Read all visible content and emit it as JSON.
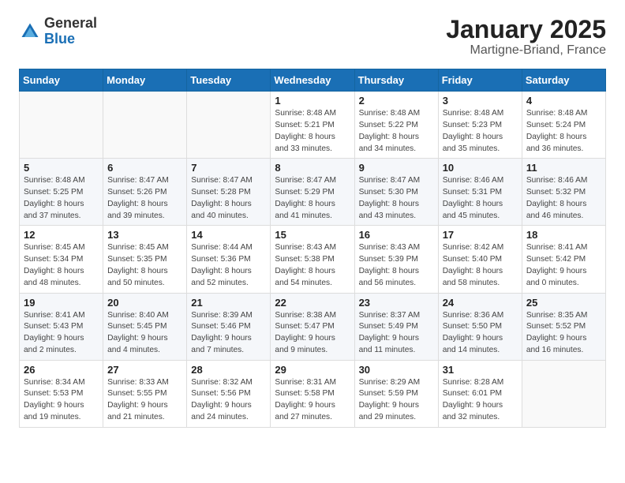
{
  "header": {
    "logo_line1": "General",
    "logo_line2": "Blue",
    "title": "January 2025",
    "subtitle": "Martigne-Briand, France"
  },
  "weekdays": [
    "Sunday",
    "Monday",
    "Tuesday",
    "Wednesday",
    "Thursday",
    "Friday",
    "Saturday"
  ],
  "weeks": [
    [
      {
        "day": "",
        "info": ""
      },
      {
        "day": "",
        "info": ""
      },
      {
        "day": "",
        "info": ""
      },
      {
        "day": "1",
        "info": "Sunrise: 8:48 AM\nSunset: 5:21 PM\nDaylight: 8 hours\nand 33 minutes."
      },
      {
        "day": "2",
        "info": "Sunrise: 8:48 AM\nSunset: 5:22 PM\nDaylight: 8 hours\nand 34 minutes."
      },
      {
        "day": "3",
        "info": "Sunrise: 8:48 AM\nSunset: 5:23 PM\nDaylight: 8 hours\nand 35 minutes."
      },
      {
        "day": "4",
        "info": "Sunrise: 8:48 AM\nSunset: 5:24 PM\nDaylight: 8 hours\nand 36 minutes."
      }
    ],
    [
      {
        "day": "5",
        "info": "Sunrise: 8:48 AM\nSunset: 5:25 PM\nDaylight: 8 hours\nand 37 minutes."
      },
      {
        "day": "6",
        "info": "Sunrise: 8:47 AM\nSunset: 5:26 PM\nDaylight: 8 hours\nand 39 minutes."
      },
      {
        "day": "7",
        "info": "Sunrise: 8:47 AM\nSunset: 5:28 PM\nDaylight: 8 hours\nand 40 minutes."
      },
      {
        "day": "8",
        "info": "Sunrise: 8:47 AM\nSunset: 5:29 PM\nDaylight: 8 hours\nand 41 minutes."
      },
      {
        "day": "9",
        "info": "Sunrise: 8:47 AM\nSunset: 5:30 PM\nDaylight: 8 hours\nand 43 minutes."
      },
      {
        "day": "10",
        "info": "Sunrise: 8:46 AM\nSunset: 5:31 PM\nDaylight: 8 hours\nand 45 minutes."
      },
      {
        "day": "11",
        "info": "Sunrise: 8:46 AM\nSunset: 5:32 PM\nDaylight: 8 hours\nand 46 minutes."
      }
    ],
    [
      {
        "day": "12",
        "info": "Sunrise: 8:45 AM\nSunset: 5:34 PM\nDaylight: 8 hours\nand 48 minutes."
      },
      {
        "day": "13",
        "info": "Sunrise: 8:45 AM\nSunset: 5:35 PM\nDaylight: 8 hours\nand 50 minutes."
      },
      {
        "day": "14",
        "info": "Sunrise: 8:44 AM\nSunset: 5:36 PM\nDaylight: 8 hours\nand 52 minutes."
      },
      {
        "day": "15",
        "info": "Sunrise: 8:43 AM\nSunset: 5:38 PM\nDaylight: 8 hours\nand 54 minutes."
      },
      {
        "day": "16",
        "info": "Sunrise: 8:43 AM\nSunset: 5:39 PM\nDaylight: 8 hours\nand 56 minutes."
      },
      {
        "day": "17",
        "info": "Sunrise: 8:42 AM\nSunset: 5:40 PM\nDaylight: 8 hours\nand 58 minutes."
      },
      {
        "day": "18",
        "info": "Sunrise: 8:41 AM\nSunset: 5:42 PM\nDaylight: 9 hours\nand 0 minutes."
      }
    ],
    [
      {
        "day": "19",
        "info": "Sunrise: 8:41 AM\nSunset: 5:43 PM\nDaylight: 9 hours\nand 2 minutes."
      },
      {
        "day": "20",
        "info": "Sunrise: 8:40 AM\nSunset: 5:45 PM\nDaylight: 9 hours\nand 4 minutes."
      },
      {
        "day": "21",
        "info": "Sunrise: 8:39 AM\nSunset: 5:46 PM\nDaylight: 9 hours\nand 7 minutes."
      },
      {
        "day": "22",
        "info": "Sunrise: 8:38 AM\nSunset: 5:47 PM\nDaylight: 9 hours\nand 9 minutes."
      },
      {
        "day": "23",
        "info": "Sunrise: 8:37 AM\nSunset: 5:49 PM\nDaylight: 9 hours\nand 11 minutes."
      },
      {
        "day": "24",
        "info": "Sunrise: 8:36 AM\nSunset: 5:50 PM\nDaylight: 9 hours\nand 14 minutes."
      },
      {
        "day": "25",
        "info": "Sunrise: 8:35 AM\nSunset: 5:52 PM\nDaylight: 9 hours\nand 16 minutes."
      }
    ],
    [
      {
        "day": "26",
        "info": "Sunrise: 8:34 AM\nSunset: 5:53 PM\nDaylight: 9 hours\nand 19 minutes."
      },
      {
        "day": "27",
        "info": "Sunrise: 8:33 AM\nSunset: 5:55 PM\nDaylight: 9 hours\nand 21 minutes."
      },
      {
        "day": "28",
        "info": "Sunrise: 8:32 AM\nSunset: 5:56 PM\nDaylight: 9 hours\nand 24 minutes."
      },
      {
        "day": "29",
        "info": "Sunrise: 8:31 AM\nSunset: 5:58 PM\nDaylight: 9 hours\nand 27 minutes."
      },
      {
        "day": "30",
        "info": "Sunrise: 8:29 AM\nSunset: 5:59 PM\nDaylight: 9 hours\nand 29 minutes."
      },
      {
        "day": "31",
        "info": "Sunrise: 8:28 AM\nSunset: 6:01 PM\nDaylight: 9 hours\nand 32 minutes."
      },
      {
        "day": "",
        "info": ""
      }
    ]
  ]
}
